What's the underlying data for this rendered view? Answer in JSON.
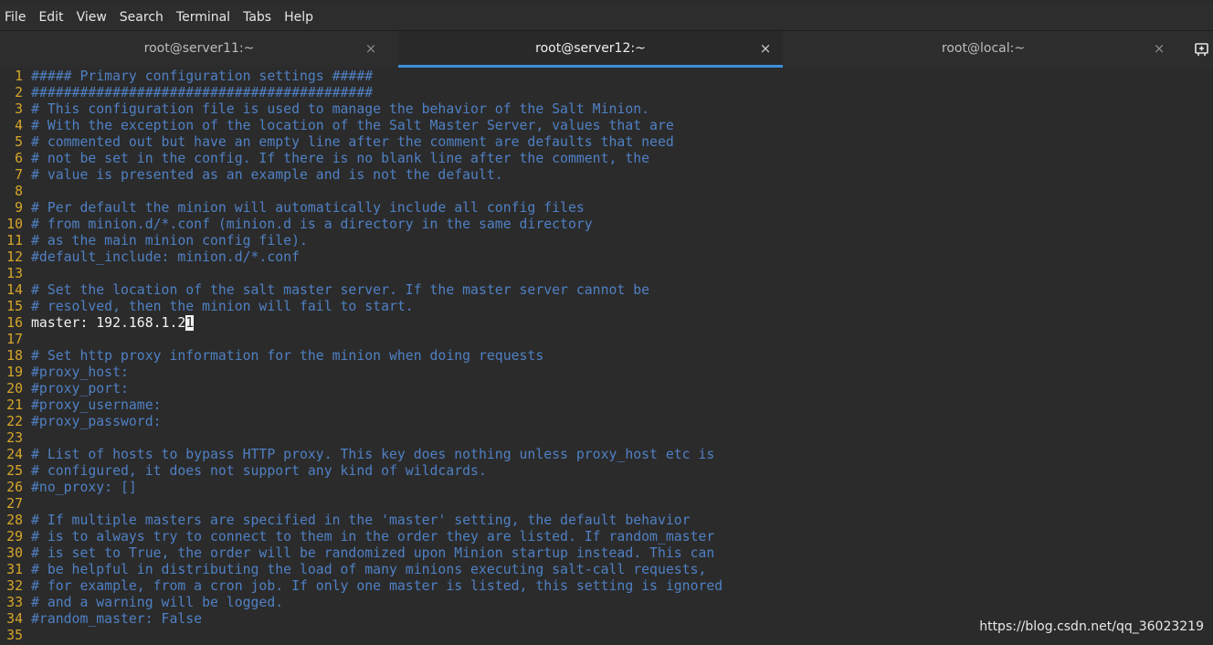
{
  "menu": [
    "File",
    "Edit",
    "View",
    "Search",
    "Terminal",
    "Tabs",
    "Help"
  ],
  "tabs": [
    {
      "label": "root@server11:~",
      "close": "×",
      "active": false
    },
    {
      "label": "root@server12:~",
      "close": "×",
      "active": true
    },
    {
      "label": "root@local:~",
      "close": "×",
      "active": false
    }
  ],
  "new_tab_icon": "new-tab-icon",
  "editor": {
    "lines": [
      {
        "num": "1",
        "text": "##### Primary configuration settings #####"
      },
      {
        "num": "2",
        "text": "##########################################"
      },
      {
        "num": "3",
        "text": "# This configuration file is used to manage the behavior of the Salt Minion."
      },
      {
        "num": "4",
        "text": "# With the exception of the location of the Salt Master Server, values that are"
      },
      {
        "num": "5",
        "text": "# commented out but have an empty line after the comment are defaults that need"
      },
      {
        "num": "6",
        "text": "# not be set in the config. If there is no blank line after the comment, the"
      },
      {
        "num": "7",
        "text": "# value is presented as an example and is not the default."
      },
      {
        "num": "8",
        "text": ""
      },
      {
        "num": "9",
        "text": "# Per default the minion will automatically include all config files"
      },
      {
        "num": "10",
        "text": "# from minion.d/*.conf (minion.d is a directory in the same directory"
      },
      {
        "num": "11",
        "text": "# as the main minion config file)."
      },
      {
        "num": "12",
        "text": "#default_include: minion.d/*.conf"
      },
      {
        "num": "13",
        "text": ""
      },
      {
        "num": "14",
        "text": "# Set the location of the salt master server. If the master server cannot be"
      },
      {
        "num": "15",
        "text": "# resolved, then the minion will fail to start."
      },
      {
        "num": "16",
        "text": "master: 192.168.1.2",
        "cursor_char": "1",
        "plain": true
      },
      {
        "num": "17",
        "text": ""
      },
      {
        "num": "18",
        "text": "# Set http proxy information for the minion when doing requests"
      },
      {
        "num": "19",
        "text": "#proxy_host:"
      },
      {
        "num": "20",
        "text": "#proxy_port:"
      },
      {
        "num": "21",
        "text": "#proxy_username:"
      },
      {
        "num": "22",
        "text": "#proxy_password:"
      },
      {
        "num": "23",
        "text": ""
      },
      {
        "num": "24",
        "text": "# List of hosts to bypass HTTP proxy. This key does nothing unless proxy_host etc is"
      },
      {
        "num": "25",
        "text": "# configured, it does not support any kind of wildcards."
      },
      {
        "num": "26",
        "text": "#no_proxy: []"
      },
      {
        "num": "27",
        "text": ""
      },
      {
        "num": "28",
        "text": "# If multiple masters are specified in the 'master' setting, the default behavior"
      },
      {
        "num": "29",
        "text": "# is to always try to connect to them in the order they are listed. If random_master"
      },
      {
        "num": "30",
        "text": "# is set to True, the order will be randomized upon Minion startup instead. This can"
      },
      {
        "num": "31",
        "text": "# be helpful in distributing the load of many minions executing salt-call requests,"
      },
      {
        "num": "32",
        "text": "# for example, from a cron job. If only one master is listed, this setting is ignored"
      },
      {
        "num": "33",
        "text": "# and a warning will be logged."
      },
      {
        "num": "34",
        "text": "#random_master: False"
      },
      {
        "num": "35",
        "text": ""
      }
    ]
  },
  "watermark": "https://blog.csdn.net/qq_36023219",
  "colors": {
    "background": "#2b2b2b",
    "line_number": "#d7a62a",
    "comment": "#4f80c4",
    "plain_text": "#f2f2f2",
    "active_tab_accent": "#3d8fd8"
  }
}
